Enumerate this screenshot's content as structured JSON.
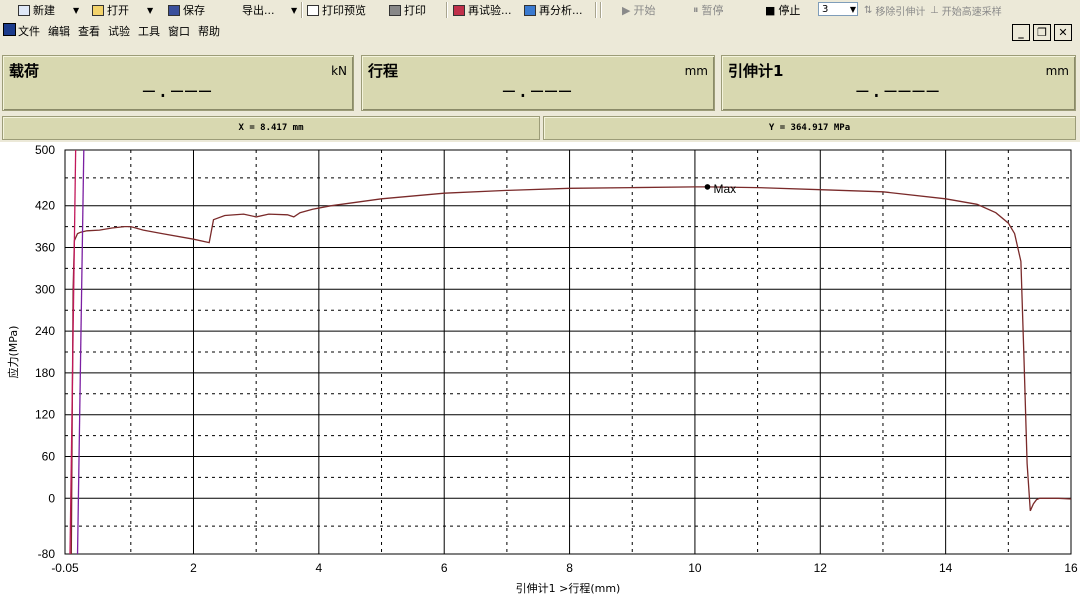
{
  "toolbar": {
    "new": "新建",
    "open": "打开",
    "save": "保存",
    "export": "导出...",
    "print_preview": "打印预览",
    "print": "打印",
    "retest": "再试验...",
    "reanalyze": "再分析...",
    "start": "开始",
    "pause": "暂停",
    "stop": "停止",
    "speed_value": "3",
    "remove_extensometer": "移除引伸计",
    "high_speed_sampling": "开始高速采样"
  },
  "menu": {
    "file": "文件",
    "edit": "编辑",
    "view": "查看",
    "test": "试验",
    "tools": "工具",
    "window": "窗口",
    "help": "帮助"
  },
  "meters": [
    {
      "label": "载荷",
      "unit": "kN",
      "value": "—.———"
    },
    {
      "label": "行程",
      "unit": "mm",
      "value": "—.———"
    },
    {
      "label": "引伸计1",
      "unit": "mm",
      "value": "—.————"
    }
  ],
  "cursor": {
    "x_readout": "X = 8.417 mm",
    "y_readout": "Y = 364.917 MPa"
  },
  "chart_data": {
    "type": "line",
    "xlabel": "引伸计1 >行程(mm)",
    "ylabel": "应力(MPa)",
    "xlim": [
      -0.05,
      16
    ],
    "ylim": [
      -80,
      500
    ],
    "x_ticks": [
      "-0.05",
      "2",
      "4",
      "6",
      "8",
      "10",
      "12",
      "14",
      "16"
    ],
    "y_ticks": [
      "-80",
      "0",
      "60",
      "120",
      "180",
      "240",
      "300",
      "360",
      "420",
      "500"
    ],
    "grid": true,
    "line_color": "#7a2a2a",
    "annotation": {
      "label": "Max",
      "x": 10.2,
      "y": 447
    },
    "series": [
      {
        "name": "",
        "x": [
          0.05,
          0.08,
          0.1,
          0.15,
          0.2,
          0.3,
          0.5,
          0.7,
          0.9,
          1.0,
          1.2,
          1.5,
          2.0,
          2.25,
          2.32,
          2.5,
          2.8,
          3.0,
          3.2,
          3.5,
          3.6,
          3.7,
          3.9,
          4.2,
          5.0,
          6.0,
          7.0,
          8.0,
          9.0,
          10.0,
          10.2,
          11.0,
          12.0,
          13.0,
          14.0,
          14.5,
          14.8,
          15.0,
          15.1,
          15.2,
          15.25,
          15.3,
          15.35,
          15.4,
          15.45,
          15.5,
          15.6,
          15.8,
          16.0
        ],
        "y": [
          -80,
          300,
          370,
          380,
          382,
          384,
          385,
          388,
          390,
          390,
          385,
          380,
          372,
          367,
          400,
          406,
          408,
          404,
          408,
          407,
          404,
          410,
          415,
          420,
          430,
          438,
          442,
          445,
          446,
          447,
          447,
          446,
          443,
          440,
          430,
          422,
          410,
          395,
          380,
          340,
          200,
          50,
          -18,
          -8,
          -2,
          0,
          0,
          0,
          -1
        ]
      }
    ]
  }
}
